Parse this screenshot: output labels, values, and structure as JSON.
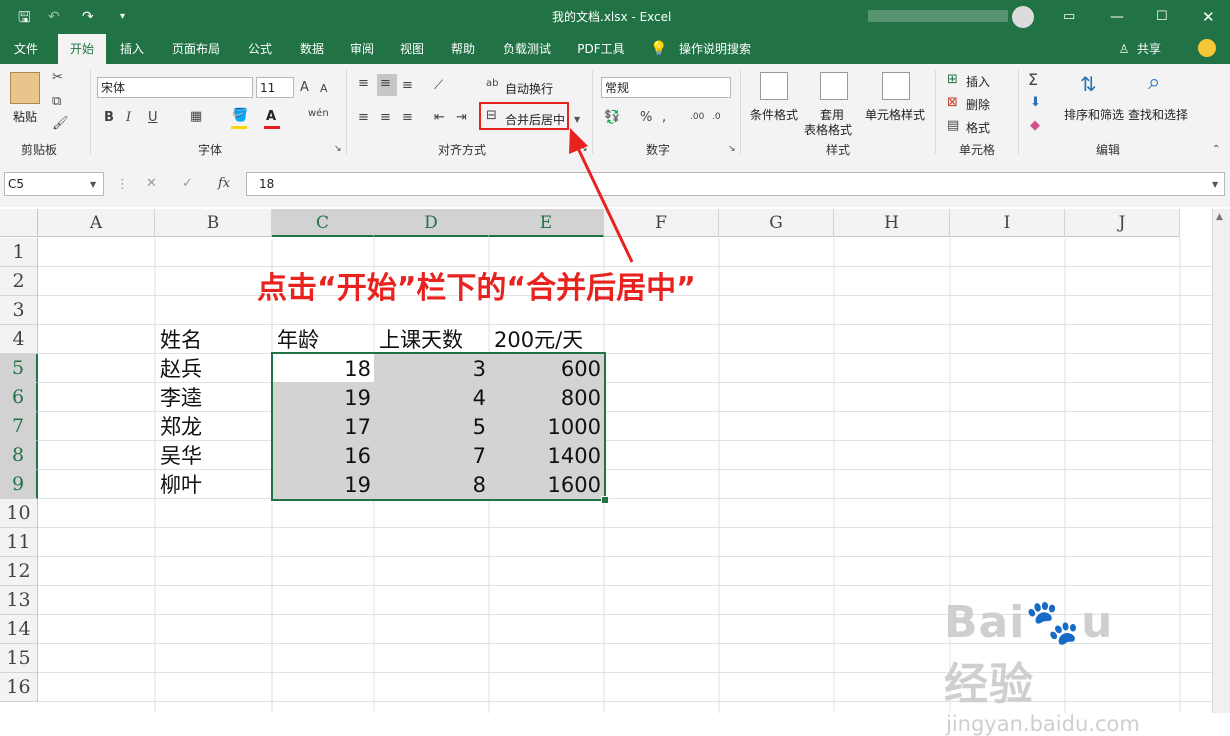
{
  "window": {
    "title": "我的文档.xlsx  -  Excel",
    "share_label": "共享"
  },
  "tabs": [
    "文件",
    "开始",
    "插入",
    "页面布局",
    "公式",
    "数据",
    "审阅",
    "视图",
    "帮助",
    "负载测试",
    "PDF工具",
    "操作说明搜索"
  ],
  "ribbon": {
    "clipboard": {
      "paste": "粘贴",
      "group": "剪贴板"
    },
    "font": {
      "name": "宋体",
      "size": "11",
      "bold": "B",
      "italic": "I",
      "underline": "U",
      "group": "字体"
    },
    "align": {
      "wrap": "自动换行",
      "merge": "合并后居中",
      "group": "对齐方式"
    },
    "number": {
      "format": "常规",
      "group": "数字"
    },
    "styles": {
      "cond": "条件格式",
      "table1": "套用",
      "table2": "表格格式",
      "cell": "单元格样式",
      "group": "样式"
    },
    "cells": {
      "insert": "插入",
      "delete": "删除",
      "format": "格式",
      "group": "单元格"
    },
    "editing": {
      "sort": "排序和筛选",
      "find": "查找和选择",
      "group": "编辑"
    }
  },
  "formula_bar": {
    "name_box": "C5",
    "fx": "fx",
    "value": "18"
  },
  "columns": [
    "A",
    "B",
    "C",
    "D",
    "E",
    "F",
    "G",
    "H",
    "I",
    "J"
  ],
  "rows": [
    "1",
    "2",
    "3",
    "4",
    "5",
    "6",
    "7",
    "8",
    "9",
    "10",
    "11",
    "12",
    "13",
    "14",
    "15",
    "16"
  ],
  "table": {
    "headers": [
      "姓名",
      "年龄",
      "上课天数",
      "200元/天"
    ],
    "rows": [
      [
        "赵兵",
        "18",
        "3",
        "600"
      ],
      [
        "李逵",
        "19",
        "4",
        "800"
      ],
      [
        "郑龙",
        "17",
        "5",
        "1000"
      ],
      [
        "吴华",
        "16",
        "7",
        "1400"
      ],
      [
        "柳叶",
        "19",
        "8",
        "1600"
      ]
    ]
  },
  "annotation": "点击“开始”栏下的“合并后居中”",
  "colors": {
    "excel_green": "#217346",
    "annotation_red": "#e8231f"
  }
}
